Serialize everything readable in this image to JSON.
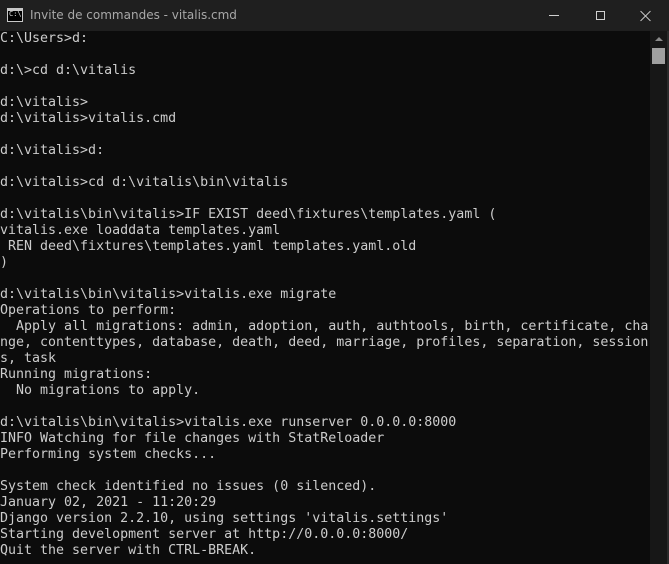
{
  "window": {
    "title": "Invite de commandes - vitalis.cmd",
    "app_icon_text": "C:\\",
    "minimize_glyph": "minimize-icon",
    "maximize_glyph": "maximize-icon",
    "close_glyph": "close-icon"
  },
  "colors": {
    "titlebar_bg": "#1f1f1f",
    "console_bg": "#0c0c0c",
    "console_text": "#cccccc"
  },
  "console": {
    "lines": [
      "C:\\Users>d:",
      "",
      "d:\\>cd d:\\vitalis",
      "",
      "d:\\vitalis>",
      "d:\\vitalis>vitalis.cmd",
      "",
      "d:\\vitalis>d:",
      "",
      "d:\\vitalis>cd d:\\vitalis\\bin\\vitalis",
      "",
      "d:\\vitalis\\bin\\vitalis>IF EXIST deed\\fixtures\\templates.yaml (",
      "vitalis.exe loaddata templates.yaml",
      " REN deed\\fixtures\\templates.yaml templates.yaml.old",
      ")",
      "",
      "d:\\vitalis\\bin\\vitalis>vitalis.exe migrate",
      "Operations to perform:",
      "  Apply all migrations: admin, adoption, auth, authtools, birth, certificate, cha",
      "nge, contenttypes, database, death, deed, marriage, profiles, separation, session",
      "s, task",
      "Running migrations:",
      "  No migrations to apply.",
      "",
      "d:\\vitalis\\bin\\vitalis>vitalis.exe runserver 0.0.0.0:8000",
      "INFO Watching for file changes with StatReloader",
      "Performing system checks...",
      "",
      "System check identified no issues (0 silenced).",
      "January 02, 2021 - 11:20:29",
      "Django version 2.2.10, using settings 'vitalis.settings'",
      "Starting development server at http://0.0.0.0:8000/",
      "Quit the server with CTRL-BREAK."
    ]
  }
}
